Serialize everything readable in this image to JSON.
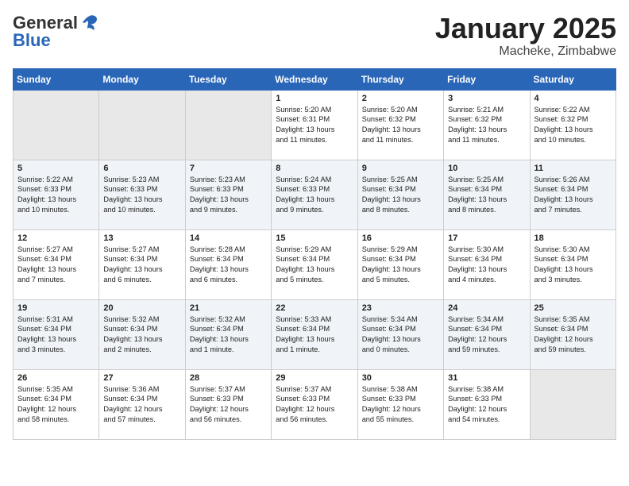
{
  "header": {
    "logo_general": "General",
    "logo_blue": "Blue",
    "title": "January 2025",
    "subtitle": "Macheke, Zimbabwe"
  },
  "weekdays": [
    "Sunday",
    "Monday",
    "Tuesday",
    "Wednesday",
    "Thursday",
    "Friday",
    "Saturday"
  ],
  "weeks": [
    [
      {
        "day": "",
        "info": ""
      },
      {
        "day": "",
        "info": ""
      },
      {
        "day": "",
        "info": ""
      },
      {
        "day": "1",
        "info": "Sunrise: 5:20 AM\nSunset: 6:31 PM\nDaylight: 13 hours\nand 11 minutes."
      },
      {
        "day": "2",
        "info": "Sunrise: 5:20 AM\nSunset: 6:32 PM\nDaylight: 13 hours\nand 11 minutes."
      },
      {
        "day": "3",
        "info": "Sunrise: 5:21 AM\nSunset: 6:32 PM\nDaylight: 13 hours\nand 11 minutes."
      },
      {
        "day": "4",
        "info": "Sunrise: 5:22 AM\nSunset: 6:32 PM\nDaylight: 13 hours\nand 10 minutes."
      }
    ],
    [
      {
        "day": "5",
        "info": "Sunrise: 5:22 AM\nSunset: 6:33 PM\nDaylight: 13 hours\nand 10 minutes."
      },
      {
        "day": "6",
        "info": "Sunrise: 5:23 AM\nSunset: 6:33 PM\nDaylight: 13 hours\nand 10 minutes."
      },
      {
        "day": "7",
        "info": "Sunrise: 5:23 AM\nSunset: 6:33 PM\nDaylight: 13 hours\nand 9 minutes."
      },
      {
        "day": "8",
        "info": "Sunrise: 5:24 AM\nSunset: 6:33 PM\nDaylight: 13 hours\nand 9 minutes."
      },
      {
        "day": "9",
        "info": "Sunrise: 5:25 AM\nSunset: 6:34 PM\nDaylight: 13 hours\nand 8 minutes."
      },
      {
        "day": "10",
        "info": "Sunrise: 5:25 AM\nSunset: 6:34 PM\nDaylight: 13 hours\nand 8 minutes."
      },
      {
        "day": "11",
        "info": "Sunrise: 5:26 AM\nSunset: 6:34 PM\nDaylight: 13 hours\nand 7 minutes."
      }
    ],
    [
      {
        "day": "12",
        "info": "Sunrise: 5:27 AM\nSunset: 6:34 PM\nDaylight: 13 hours\nand 7 minutes."
      },
      {
        "day": "13",
        "info": "Sunrise: 5:27 AM\nSunset: 6:34 PM\nDaylight: 13 hours\nand 6 minutes."
      },
      {
        "day": "14",
        "info": "Sunrise: 5:28 AM\nSunset: 6:34 PM\nDaylight: 13 hours\nand 6 minutes."
      },
      {
        "day": "15",
        "info": "Sunrise: 5:29 AM\nSunset: 6:34 PM\nDaylight: 13 hours\nand 5 minutes."
      },
      {
        "day": "16",
        "info": "Sunrise: 5:29 AM\nSunset: 6:34 PM\nDaylight: 13 hours\nand 5 minutes."
      },
      {
        "day": "17",
        "info": "Sunrise: 5:30 AM\nSunset: 6:34 PM\nDaylight: 13 hours\nand 4 minutes."
      },
      {
        "day": "18",
        "info": "Sunrise: 5:30 AM\nSunset: 6:34 PM\nDaylight: 13 hours\nand 3 minutes."
      }
    ],
    [
      {
        "day": "19",
        "info": "Sunrise: 5:31 AM\nSunset: 6:34 PM\nDaylight: 13 hours\nand 3 minutes."
      },
      {
        "day": "20",
        "info": "Sunrise: 5:32 AM\nSunset: 6:34 PM\nDaylight: 13 hours\nand 2 minutes."
      },
      {
        "day": "21",
        "info": "Sunrise: 5:32 AM\nSunset: 6:34 PM\nDaylight: 13 hours\nand 1 minute."
      },
      {
        "day": "22",
        "info": "Sunrise: 5:33 AM\nSunset: 6:34 PM\nDaylight: 13 hours\nand 1 minute."
      },
      {
        "day": "23",
        "info": "Sunrise: 5:34 AM\nSunset: 6:34 PM\nDaylight: 13 hours\nand 0 minutes."
      },
      {
        "day": "24",
        "info": "Sunrise: 5:34 AM\nSunset: 6:34 PM\nDaylight: 12 hours\nand 59 minutes."
      },
      {
        "day": "25",
        "info": "Sunrise: 5:35 AM\nSunset: 6:34 PM\nDaylight: 12 hours\nand 59 minutes."
      }
    ],
    [
      {
        "day": "26",
        "info": "Sunrise: 5:35 AM\nSunset: 6:34 PM\nDaylight: 12 hours\nand 58 minutes."
      },
      {
        "day": "27",
        "info": "Sunrise: 5:36 AM\nSunset: 6:34 PM\nDaylight: 12 hours\nand 57 minutes."
      },
      {
        "day": "28",
        "info": "Sunrise: 5:37 AM\nSunset: 6:33 PM\nDaylight: 12 hours\nand 56 minutes."
      },
      {
        "day": "29",
        "info": "Sunrise: 5:37 AM\nSunset: 6:33 PM\nDaylight: 12 hours\nand 56 minutes."
      },
      {
        "day": "30",
        "info": "Sunrise: 5:38 AM\nSunset: 6:33 PM\nDaylight: 12 hours\nand 55 minutes."
      },
      {
        "day": "31",
        "info": "Sunrise: 5:38 AM\nSunset: 6:33 PM\nDaylight: 12 hours\nand 54 minutes."
      },
      {
        "day": "",
        "info": ""
      }
    ]
  ]
}
